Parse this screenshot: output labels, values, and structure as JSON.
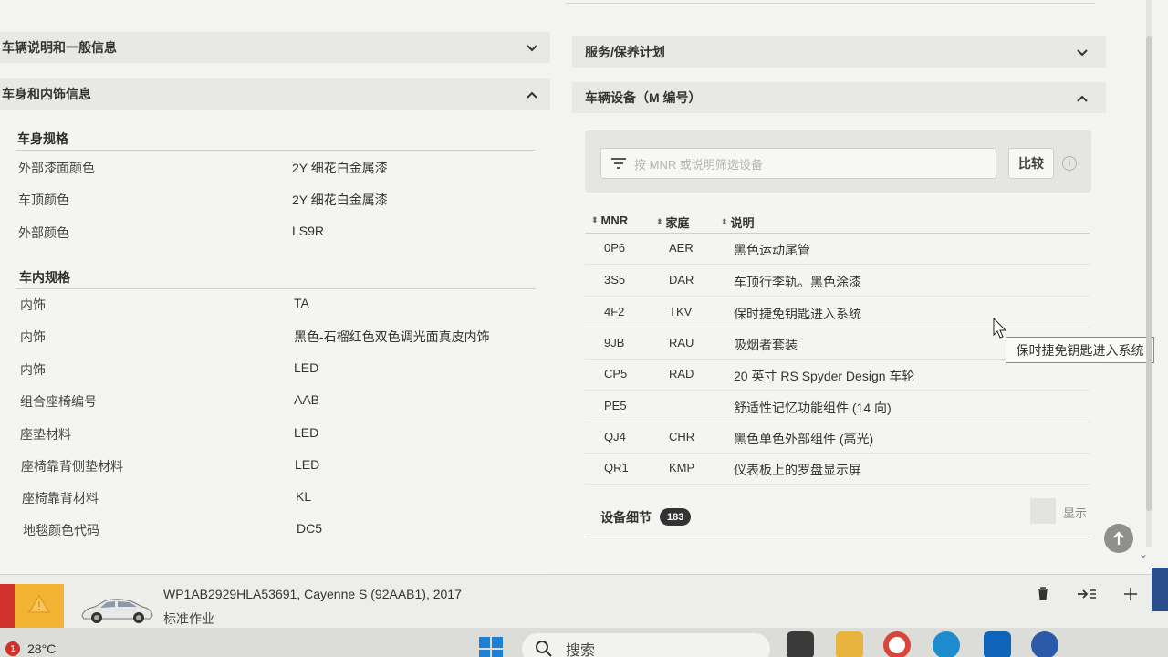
{
  "left_panel": {
    "header_general": "车辆说明和一般信息",
    "header_body_interior": "车身和内饰信息",
    "body_spec": {
      "title": "车身规格",
      "rows": [
        {
          "key": "外部漆面颜色",
          "value": "2Y 细花白金属漆"
        },
        {
          "key": "车顶颜色",
          "value": "2Y 细花白金属漆"
        },
        {
          "key": "外部颜色",
          "value": "LS9R"
        }
      ]
    },
    "interior_spec": {
      "title": "车内规格",
      "rows": [
        {
          "key": "内饰",
          "value": "TA"
        },
        {
          "key": "内饰",
          "value": "黑色-石榴红色双色调光面真皮内饰"
        },
        {
          "key": "内饰",
          "value": "LED"
        },
        {
          "key": "组合座椅编号",
          "value": "AAB"
        },
        {
          "key": "座垫材料",
          "value": "LED"
        },
        {
          "key": "座椅靠背侧垫材料",
          "value": "LED"
        },
        {
          "key": "座椅靠背材料",
          "value": "KL"
        },
        {
          "key": "地毯颜色代码",
          "value": "DC5"
        }
      ]
    }
  },
  "right_panel": {
    "header_service": "服务/保养计划",
    "header_equipment": "车辆设备（M 编号）",
    "filter_placeholder": "按 MNR 或说明筛选设备",
    "compare_label": "比较",
    "info_icon": "i",
    "columns": {
      "mnr": "MNR",
      "family": "家庭",
      "desc": "说明"
    },
    "rows": [
      {
        "mnr": "0P6",
        "family": "AER",
        "desc": "黑色运动尾管"
      },
      {
        "mnr": "3S5",
        "family": "DAR",
        "desc": "车顶行李轨。黑色涂漆"
      },
      {
        "mnr": "4F2",
        "family": "TKV",
        "desc": "保时捷免钥匙进入系统"
      },
      {
        "mnr": "9JB",
        "family": "RAU",
        "desc": "吸烟者套装"
      },
      {
        "mnr": "CP5",
        "family": "RAD",
        "desc": "20 英寸 RS Spyder Design 车轮"
      },
      {
        "mnr": "PE5",
        "family": "",
        "desc": "舒适性记忆功能组件 (14 向)"
      },
      {
        "mnr": "QJ4",
        "family": "CHR",
        "desc": "黑色单色外部组件 (高光)"
      },
      {
        "mnr": "QR1",
        "family": "KMP",
        "desc": "仪表板上的罗盘显示屏"
      }
    ],
    "tooltip": "保时捷免钥匙进入系统",
    "details_label": "设备细节",
    "details_count": "183",
    "show_label": "显示"
  },
  "bottom_bar": {
    "vehicle": "WP1AB2929HLA53691, Cayenne S (92AAB1), 2017",
    "job": "标准作业",
    "colors": {
      "warning": "#f2b233",
      "alert": "#d0312d"
    }
  },
  "taskbar": {
    "alert_count": "1",
    "temperature": "28°C",
    "search_label": "搜索"
  }
}
